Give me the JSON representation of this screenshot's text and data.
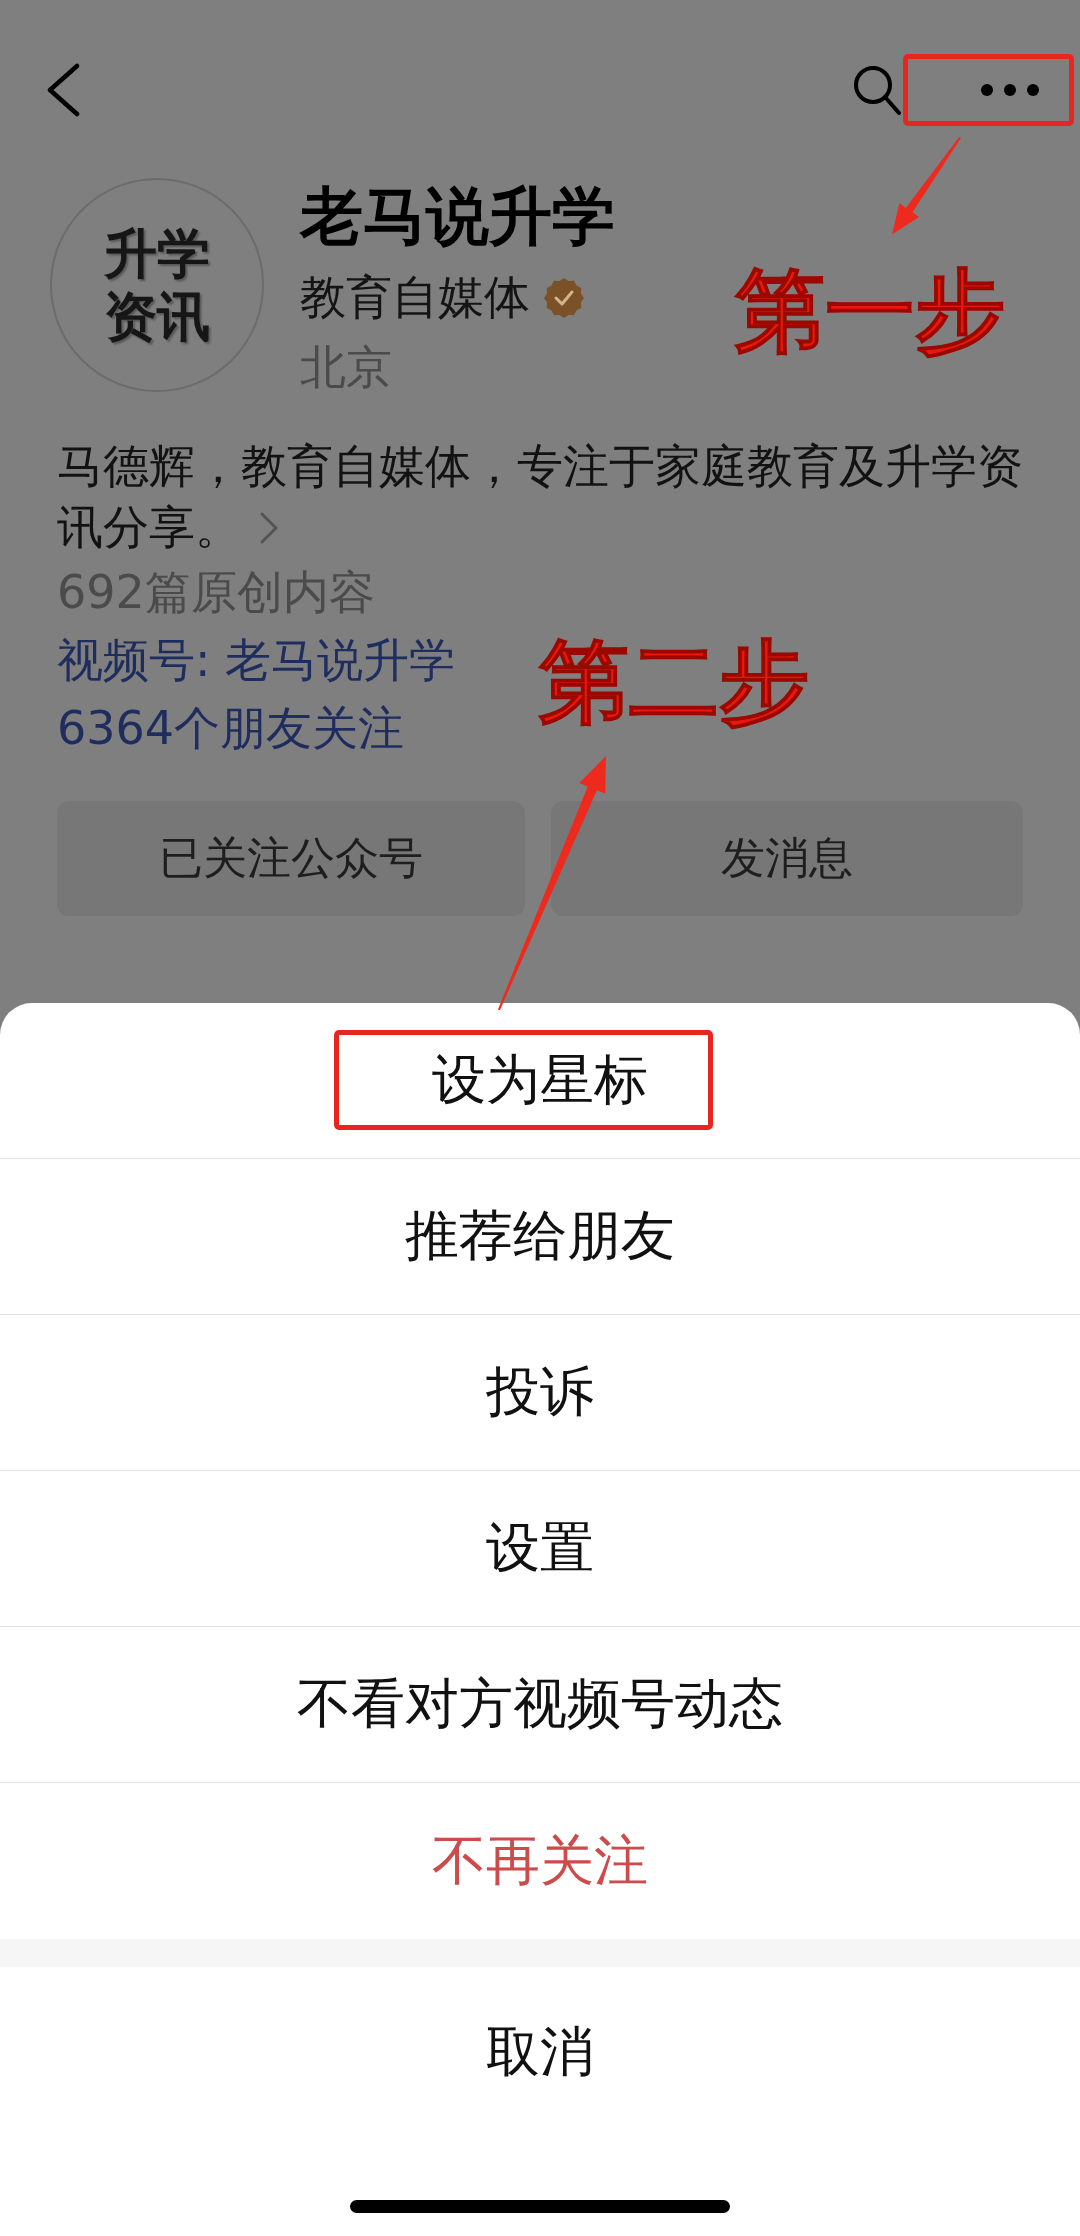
{
  "header": {
    "more_button": {
      "highlighted": true
    }
  },
  "profile": {
    "avatar_text": "升学资讯",
    "name": "老马说升学",
    "category": "教育自媒体",
    "verified": true,
    "location": "北京",
    "bio": "马德辉，教育自媒体，专注于家庭教育及升学资讯分享。",
    "article_count": "692篇原创内容",
    "channel_link": "视频号: 老马说升学",
    "friends_following": "6364个朋友关注"
  },
  "actions": [
    {
      "label": "已关注公众号"
    },
    {
      "label": "发消息"
    }
  ],
  "annotations": {
    "step_one": "第一步",
    "step_two": "第二步"
  },
  "action_sheet": {
    "items": [
      {
        "label": "设为星标",
        "kind": "normal",
        "highlighted": true
      },
      {
        "label": "推荐给朋友",
        "kind": "normal",
        "highlighted": false
      },
      {
        "label": "投诉",
        "kind": "normal",
        "highlighted": false
      },
      {
        "label": "设置",
        "kind": "normal",
        "highlighted": false
      },
      {
        "label": "不看对方视频号动态",
        "kind": "normal",
        "highlighted": false
      },
      {
        "label": "不再关注",
        "kind": "destructive",
        "highlighted": false
      }
    ],
    "cancel": "取消"
  }
}
